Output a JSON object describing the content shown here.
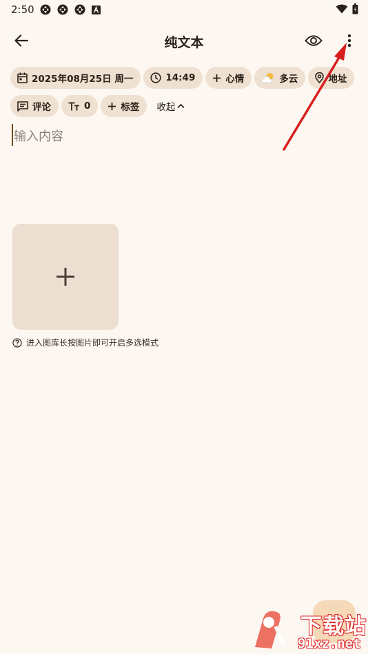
{
  "status_bar": {
    "time": "2:50",
    "left_icons": [
      "aperture-icon",
      "aperture-icon",
      "aperture-icon",
      "font-a-icon"
    ],
    "right_icons": [
      "wifi-icon",
      "battery-icon"
    ]
  },
  "toolbar": {
    "title": "纯文本",
    "back_icon": "arrow-left-icon",
    "preview_icon": "eye-icon",
    "more_icon": "more-vertical-icon"
  },
  "chips_row1": [
    {
      "id": "date",
      "icon": "calendar-icon",
      "label": "2025年08月25日 周一"
    },
    {
      "id": "time",
      "icon": "clock-icon",
      "label": "14:49"
    },
    {
      "id": "mood",
      "icon": "plus-icon",
      "label": "心情"
    },
    {
      "id": "weather",
      "icon": "partly-cloudy-icon",
      "label": "多云"
    },
    {
      "id": "location",
      "icon": "location-pin-icon",
      "label": "地址"
    }
  ],
  "chips_row2": [
    {
      "id": "comment",
      "icon": "comment-icon",
      "label": "评论"
    },
    {
      "id": "word-count",
      "icon": "text-size-icon",
      "label": "0"
    },
    {
      "id": "tag",
      "icon": "plus-icon",
      "label": "标签"
    }
  ],
  "collapse": {
    "label": "收起",
    "icon": "chevron-up-icon"
  },
  "editor": {
    "placeholder": "输入内容"
  },
  "gallery": {
    "add_icon": "plus-icon",
    "hint": "进入图库长按图片即可开启多选模式",
    "hint_icon": "help-circle-icon"
  },
  "fab": {
    "icon": "check-icon"
  },
  "watermark": {
    "name": "下载站",
    "url": "91xz.net"
  },
  "colors": {
    "background": "#fdf7f2",
    "chip": "#efe0d1",
    "tile": "#ecdfd1",
    "fab": "#f5d9b8",
    "annotation_arrow": "#d81e1e"
  }
}
